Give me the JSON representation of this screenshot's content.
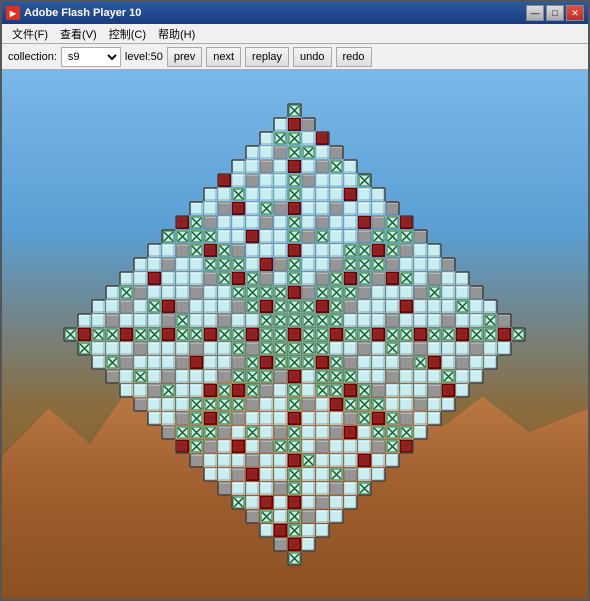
{
  "window": {
    "title": "Adobe Flash Player 10",
    "icon": "▶"
  },
  "title_controls": {
    "minimize": "—",
    "maximize": "□",
    "close": "✕"
  },
  "menu": {
    "items": [
      {
        "label": "文件(F)",
        "id": "file"
      },
      {
        "label": "查看(V)",
        "id": "view"
      },
      {
        "label": "控制(C)",
        "id": "control"
      },
      {
        "label": "帮助(H)",
        "id": "help"
      }
    ]
  },
  "toolbar": {
    "collection_label": "collection:",
    "collection_value": "s9",
    "level_label": "level:50",
    "prev_label": "prev",
    "next_label": "next",
    "replay_label": "replay",
    "undo_label": "undo",
    "redo_label": "redo"
  },
  "colors": {
    "accent": "#2a5a9f",
    "tile_light": "#c8eef0",
    "tile_dark_border": "#888",
    "tile_green": "#207020",
    "tile_dark_red": "#8b0000",
    "tile_gray": "#909090"
  }
}
